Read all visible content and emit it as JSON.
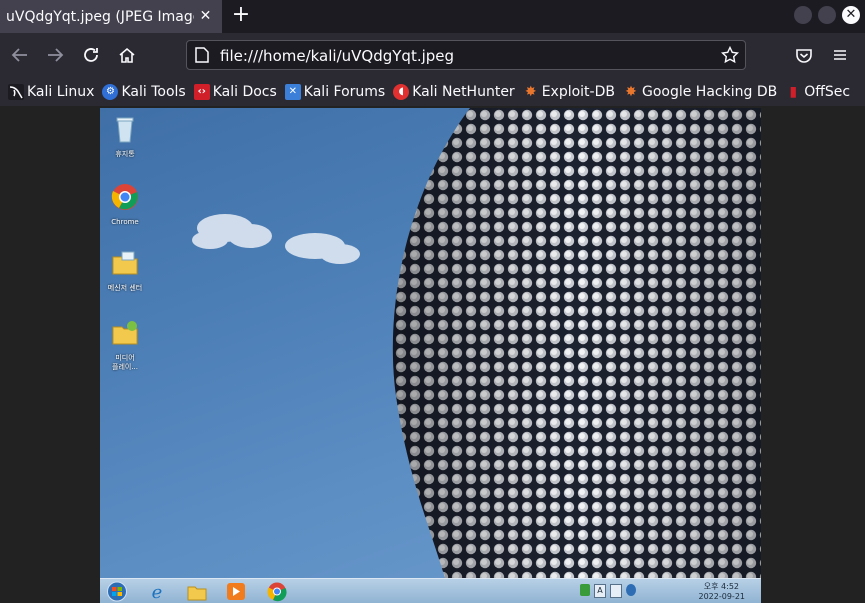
{
  "tab": {
    "title": "uVQdgYqt.jpeg (JPEG Image,",
    "close": "✕"
  },
  "new_tab": "+",
  "address": {
    "url": "file:///home/kali/uVQdgYqt.jpeg"
  },
  "bookmarks": [
    {
      "label": "Kali Linux",
      "icon": "kali-dragon-icon",
      "color": "#1c1b22"
    },
    {
      "label": "Kali Tools",
      "icon": "kali-tools-icon",
      "color": "#2f6fd6"
    },
    {
      "label": "Kali Docs",
      "icon": "kali-docs-icon",
      "color": "#d11f2a"
    },
    {
      "label": "Kali Forums",
      "icon": "kali-forums-icon",
      "color": "#3b7fd9"
    },
    {
      "label": "Kali NetHunter",
      "icon": "nethunter-icon",
      "color": "#e03030"
    },
    {
      "label": "Exploit-DB",
      "icon": "exploit-db-icon",
      "color": "#e8762d"
    },
    {
      "label": "Google Hacking DB",
      "icon": "ghdb-icon",
      "color": "#e8762d"
    },
    {
      "label": "OffSec",
      "icon": "offsec-icon",
      "color": "#d11f2a"
    }
  ],
  "desktop_icons": [
    {
      "label": "휴지통",
      "icon": "recycle-bin-icon"
    },
    {
      "label": "Chrome",
      "icon": "chrome-icon"
    },
    {
      "label": "메신저 센터",
      "icon": "messenger-folder-icon"
    },
    {
      "label": "미디어\n플레이...",
      "icon": "media-player-folder-icon"
    }
  ],
  "taskbar": {
    "clock_time": "오후 4:52",
    "clock_date": "2022-09-21",
    "items": [
      "start-orb-icon",
      "internet-explorer-icon",
      "file-explorer-icon",
      "media-player-icon",
      "chrome-icon"
    ]
  },
  "colors": {
    "chrome_dark": "#1c1b22",
    "toolbar": "#2b2a33",
    "tab_active": "#42414d",
    "sky": "#4b7db5"
  }
}
